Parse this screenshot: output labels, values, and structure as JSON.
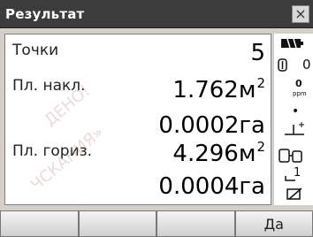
{
  "window": {
    "title": "Результат"
  },
  "rows": [
    {
      "label": "Точки",
      "value": "5",
      "unit": "",
      "sup": ""
    },
    {
      "label": "Пл. накл.",
      "value": "1.762м",
      "sup": "2"
    },
    {
      "label": "",
      "value": "0.0002га",
      "sup": ""
    },
    {
      "label": "Пл. гориз.",
      "value": "4.296м",
      "sup": "2"
    },
    {
      "label": "",
      "value": "0.0004га",
      "sup": ""
    }
  ],
  "indicators": {
    "prism_const": "0",
    "ppm": "0",
    "ppm_label": "ppm",
    "step": "1"
  },
  "softkeys": [
    "",
    "",
    "",
    "Да"
  ],
  "watermark": [
    "ДЕНО!",
    "ЧСКАНИЯ»"
  ]
}
